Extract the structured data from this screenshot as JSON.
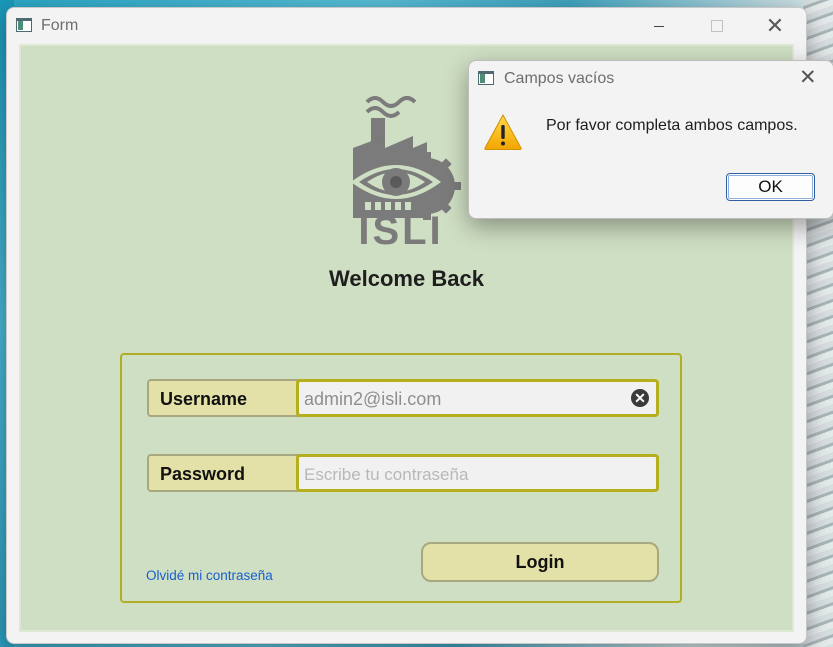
{
  "window": {
    "title": "Form",
    "controls": {
      "minimize_icon": "minimize-icon",
      "maximize_icon": "maximize-icon",
      "close_glyph": "✕"
    }
  },
  "logo": {
    "text": "ISLI",
    "icon": "factory-eye-gear-logo"
  },
  "welcome": "Welcome Back",
  "form": {
    "username_label": "Username",
    "username_value": "admin2@isli.com",
    "clear_glyph": "✕",
    "password_label": "Password",
    "password_placeholder": "Escribe tu contraseña",
    "forgot_link": "Olvidé mi contraseña",
    "login_label": "Login"
  },
  "dialog": {
    "title": "Campos vacíos",
    "close_glyph": "✕",
    "message": "Por favor completa ambos campos.",
    "ok_label": "OK",
    "icon": "warning-icon"
  },
  "colors": {
    "client_bg": "#cfdfc3",
    "panel_border": "#b1ae26",
    "label_bg": "#e4e1a8",
    "link": "#1a5fd0"
  }
}
